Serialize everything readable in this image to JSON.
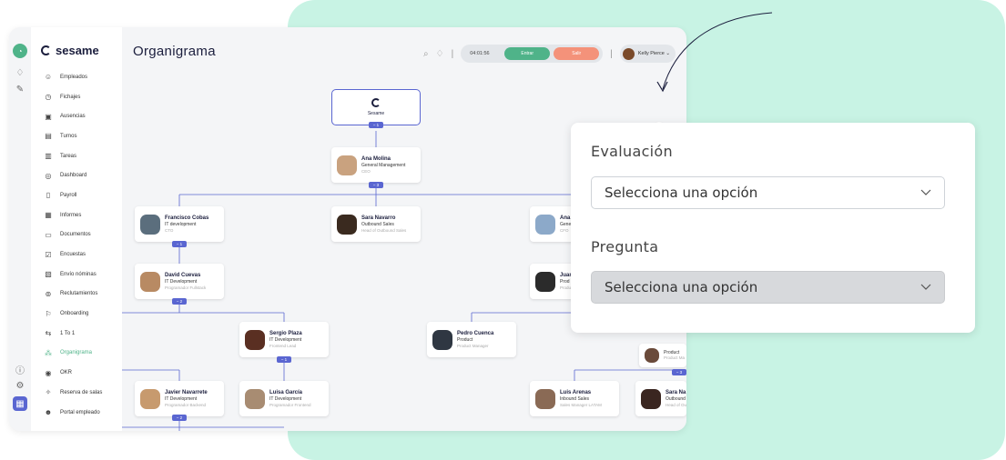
{
  "app": {
    "brand": "sesame",
    "page_title": "Organigrama"
  },
  "topbar": {
    "clock": "04:01:56",
    "enter_label": "Entrar",
    "exit_label": "Salir",
    "user_name": "Kelly Pierce ⌄"
  },
  "sidebar": {
    "items": [
      {
        "label": "Empleados",
        "icon": "users-icon"
      },
      {
        "label": "Fichajes",
        "icon": "clock-icon"
      },
      {
        "label": "Ausencias",
        "icon": "calendar-x-icon"
      },
      {
        "label": "Turnos",
        "icon": "calendar-icon"
      },
      {
        "label": "Tareas",
        "icon": "clipboard-icon"
      },
      {
        "label": "Dashboard",
        "icon": "dashboard-icon"
      },
      {
        "label": "Payroll",
        "icon": "document-icon"
      },
      {
        "label": "Informes",
        "icon": "report-icon"
      },
      {
        "label": "Documentos",
        "icon": "folder-icon"
      },
      {
        "label": "Encuestas",
        "icon": "checkbox-icon"
      },
      {
        "label": "Envío nóminas",
        "icon": "send-doc-icon"
      },
      {
        "label": "Reclutamientos",
        "icon": "recruit-icon"
      },
      {
        "label": "Onboarding",
        "icon": "onboarding-icon"
      },
      {
        "label": "1 To 1",
        "icon": "one-to-one-icon"
      },
      {
        "label": "Organigrama",
        "icon": "org-chart-icon",
        "active": true
      },
      {
        "label": "OKR",
        "icon": "target-icon"
      },
      {
        "label": "Reserva de salas",
        "icon": "pin-icon"
      },
      {
        "label": "Portal empleado",
        "icon": "portal-icon"
      }
    ]
  },
  "org": {
    "root": {
      "label": "Sesame",
      "count": "− 1"
    },
    "nodes": {
      "ana": {
        "name": "Ana Molina",
        "dept": "General Management",
        "role": "CEO",
        "count": "− 3"
      },
      "francisco": {
        "name": "Francisco Cobas",
        "dept": "IT development",
        "role": "CTO",
        "count": "− 1"
      },
      "sara1": {
        "name": "Sara Navarro",
        "dept": "Outbound Sales",
        "role": "Head of Outbound Sales"
      },
      "ana2": {
        "name": "Ana",
        "dept": "Gene",
        "role": "CFO"
      },
      "david": {
        "name": "David Cuevas",
        "dept": "IT Development",
        "role": "Programador Fullstack",
        "count": "− 2"
      },
      "juan": {
        "name": "Juan",
        "dept": "Prod",
        "role": "Produ"
      },
      "sergio": {
        "name": "Sergio Plaza",
        "dept": "IT Development",
        "role": "Frontend Lead",
        "count": "− 1"
      },
      "pedro": {
        "name": "Pedro Cuenca",
        "dept": "Product",
        "role": "Product Manager"
      },
      "product": {
        "dept": "Product",
        "role": "Product Ma",
        "count": "− 3"
      },
      "javier": {
        "name": "Javier Navarrete",
        "dept": "IT Development",
        "role": "Programador Backend",
        "count": "− 2"
      },
      "luisa": {
        "name": "Luisa García",
        "dept": "IT Development",
        "role": "Programador Frontend"
      },
      "luis": {
        "name": "Luis Arenas",
        "dept": "Inbound Sales",
        "role": "Sales Manager LATAM"
      },
      "sara2": {
        "name": "Sara Na",
        "dept": "Outbound",
        "role": "Head of Ou"
      }
    }
  },
  "panel": {
    "field1_label": "Evaluación",
    "field1_value": "Selecciona una opción",
    "field2_label": "Pregunta",
    "field2_value": "Selecciona una opción"
  },
  "colors": {
    "accent": "#5a66d1",
    "brand_green": "#4fb389",
    "exit_red": "#f4927a",
    "mint_background": "#c8f3e4"
  }
}
